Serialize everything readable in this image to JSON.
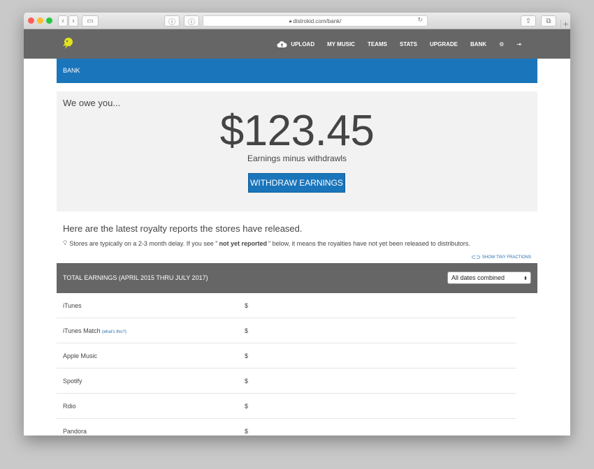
{
  "browser": {
    "url": "distrokid.com/bank/"
  },
  "nav": {
    "items": [
      {
        "label": "UPLOAD",
        "icon": "cloud-upload-icon"
      },
      {
        "label": "MY MUSIC"
      },
      {
        "label": "TEAMS"
      },
      {
        "label": "STATS"
      },
      {
        "label": "UPGRADE"
      },
      {
        "label": "BANK"
      }
    ],
    "settings_icon": "gear-icon",
    "logout_icon": "sign-out-icon"
  },
  "bank_bar": {
    "title": "BANK"
  },
  "owe": {
    "label": "We owe you...",
    "amount": "$123.45",
    "subtitle": "Earnings minus withdrawls",
    "button": "WITHDRAW EARNINGS"
  },
  "reports": {
    "heading": "Here are the latest royalty reports the stores have released.",
    "note_before": "Stores are typically on a 2-3 month delay. If you see \"",
    "note_bold": "not yet reported",
    "note_after": "\" below, it means the royalties have not yet been released to distributors.",
    "tiny_fractions": "SHOW TINY FRACTIONS"
  },
  "totals": {
    "label": "TOTAL EARNINGS (APRIL 2015 THRU JULY 2017)",
    "select_value": "All dates combined"
  },
  "stores": [
    {
      "name": "iTunes",
      "link": "",
      "amount": "$"
    },
    {
      "name": "iTunes Match",
      "link": "(what's this?)",
      "amount": "$"
    },
    {
      "name": "Apple Music",
      "link": "",
      "amount": "$"
    },
    {
      "name": "Spotify",
      "link": "",
      "amount": "$"
    },
    {
      "name": "Rdio",
      "link": "",
      "amount": "$"
    },
    {
      "name": "Pandora",
      "link": "",
      "amount": "$"
    }
  ],
  "colors": {
    "accent": "#1a75bb",
    "nav_bg": "#666666",
    "logo": "#e2e31e"
  }
}
